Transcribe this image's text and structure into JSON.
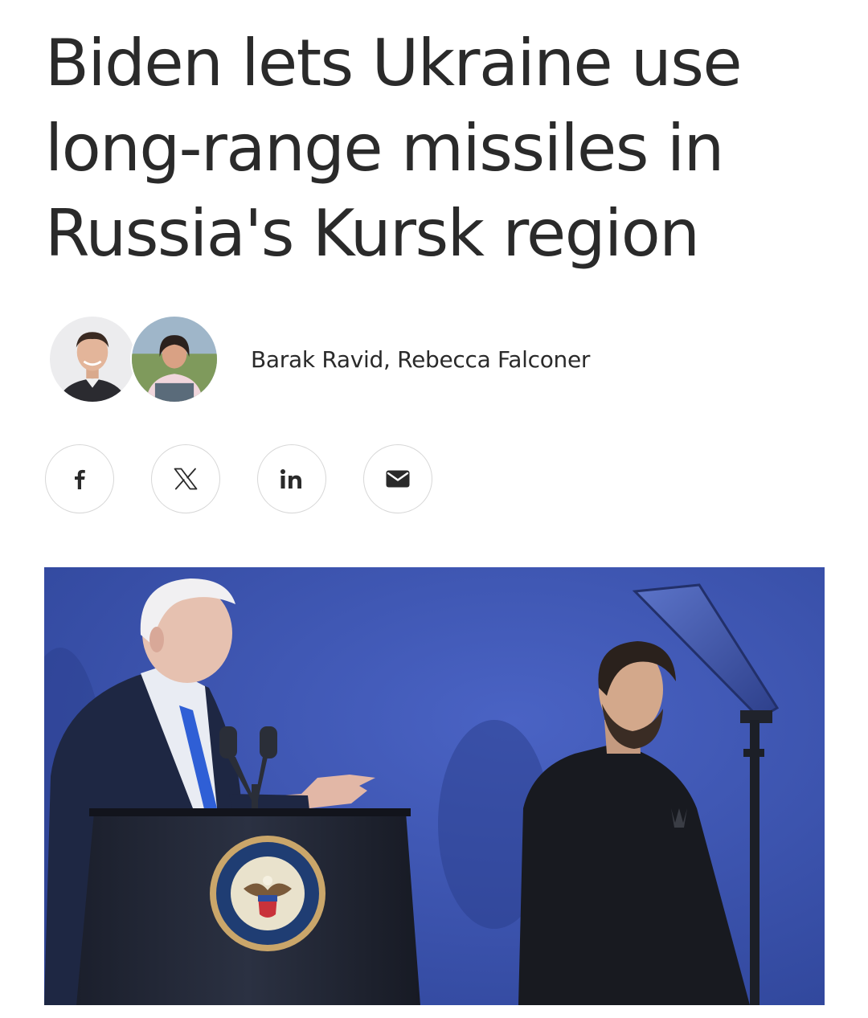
{
  "article": {
    "headline": "Biden lets Ukraine use long-range missiles in Russia's Kursk region",
    "authors": "Barak Ravid, Rebecca Falconer"
  },
  "avatars": [
    {
      "icon": "author-avatar-icon"
    },
    {
      "icon": "author-avatar-icon"
    }
  ],
  "share": [
    {
      "icon": "facebook-icon"
    },
    {
      "icon": "x-icon"
    },
    {
      "icon": "linkedin-icon"
    },
    {
      "icon": "email-icon"
    }
  ],
  "colors": {
    "text": "#2a2a2a",
    "share_border": "#d7d7d7",
    "photo_backdrop": "#3d55b3"
  }
}
